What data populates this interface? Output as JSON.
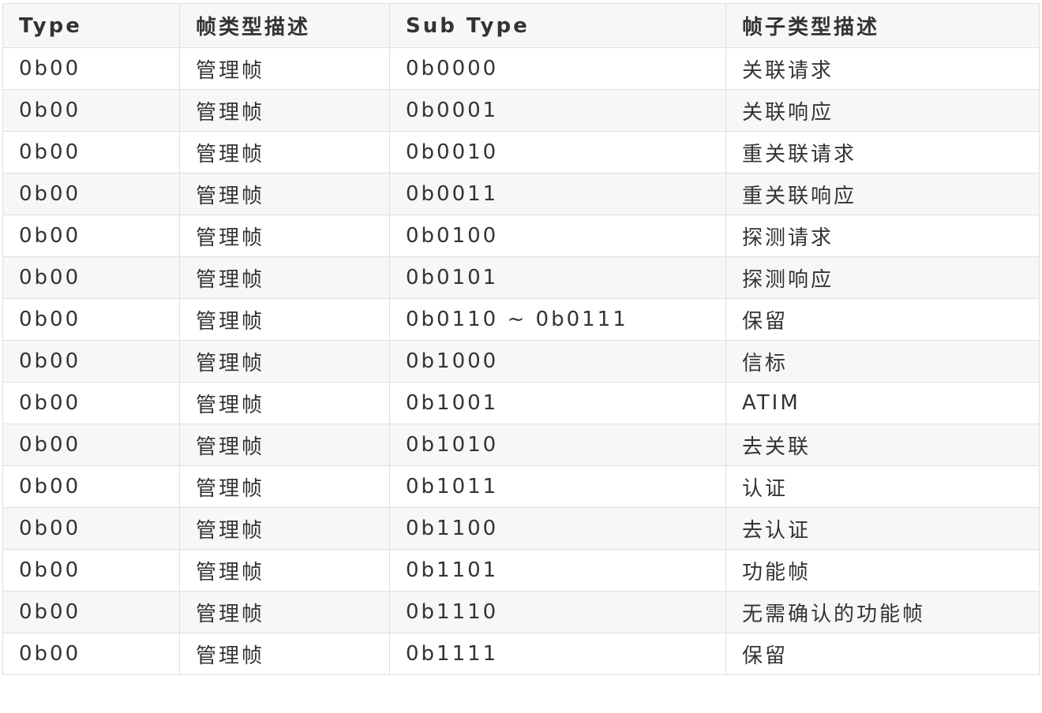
{
  "table": {
    "headers": [
      "Type",
      "帧类型描述",
      "Sub Type",
      "帧子类型描述"
    ],
    "rows": [
      [
        "0b00",
        "管理帧",
        "0b0000",
        "关联请求"
      ],
      [
        "0b00",
        "管理帧",
        "0b0001",
        "关联响应"
      ],
      [
        "0b00",
        "管理帧",
        "0b0010",
        "重关联请求"
      ],
      [
        "0b00",
        "管理帧",
        "0b0011",
        "重关联响应"
      ],
      [
        "0b00",
        "管理帧",
        "0b0100",
        "探测请求"
      ],
      [
        "0b00",
        "管理帧",
        "0b0101",
        "探测响应"
      ],
      [
        "0b00",
        "管理帧",
        "0b0110 ~ 0b0111",
        "保留"
      ],
      [
        "0b00",
        "管理帧",
        "0b1000",
        "信标"
      ],
      [
        "0b00",
        "管理帧",
        "0b1001",
        "ATIM"
      ],
      [
        "0b00",
        "管理帧",
        "0b1010",
        "去关联"
      ],
      [
        "0b00",
        "管理帧",
        "0b1011",
        "认证"
      ],
      [
        "0b00",
        "管理帧",
        "0b1100",
        "去认证"
      ],
      [
        "0b00",
        "管理帧",
        "0b1101",
        "功能帧"
      ],
      [
        "0b00",
        "管理帧",
        "0b1110",
        "无需确认的功能帧"
      ],
      [
        "0b00",
        "管理帧",
        "0b1111",
        "保留"
      ]
    ]
  }
}
